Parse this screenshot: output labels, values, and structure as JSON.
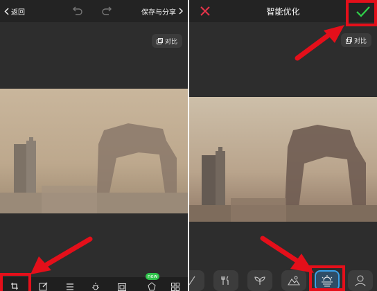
{
  "left": {
    "back_label": "返回",
    "save_share_label": "保存与分享",
    "compare_label": "对比",
    "new_badge": "new",
    "toolbar_icons": [
      "crop-icon",
      "edit-icon",
      "adjust-icon",
      "brightness-icon",
      "frame-icon",
      "sticker-icon",
      "more-icon"
    ]
  },
  "right": {
    "title": "智能优化",
    "compare_label": "对比",
    "filters": [
      {
        "icon": "portrait-icon",
        "active": false
      },
      {
        "icon": "food-icon",
        "active": false
      },
      {
        "icon": "plant-icon",
        "active": false
      },
      {
        "icon": "landscape-icon",
        "active": false
      },
      {
        "icon": "sunset-icon",
        "active": true
      },
      {
        "icon": "person-icon",
        "active": false
      }
    ]
  },
  "colors": {
    "highlight": "#e40f1a",
    "confirm": "#2fd44a",
    "close": "#e8344a",
    "active_filter_border": "#3aa0e8",
    "panel_bg": "#2d2d2d"
  }
}
